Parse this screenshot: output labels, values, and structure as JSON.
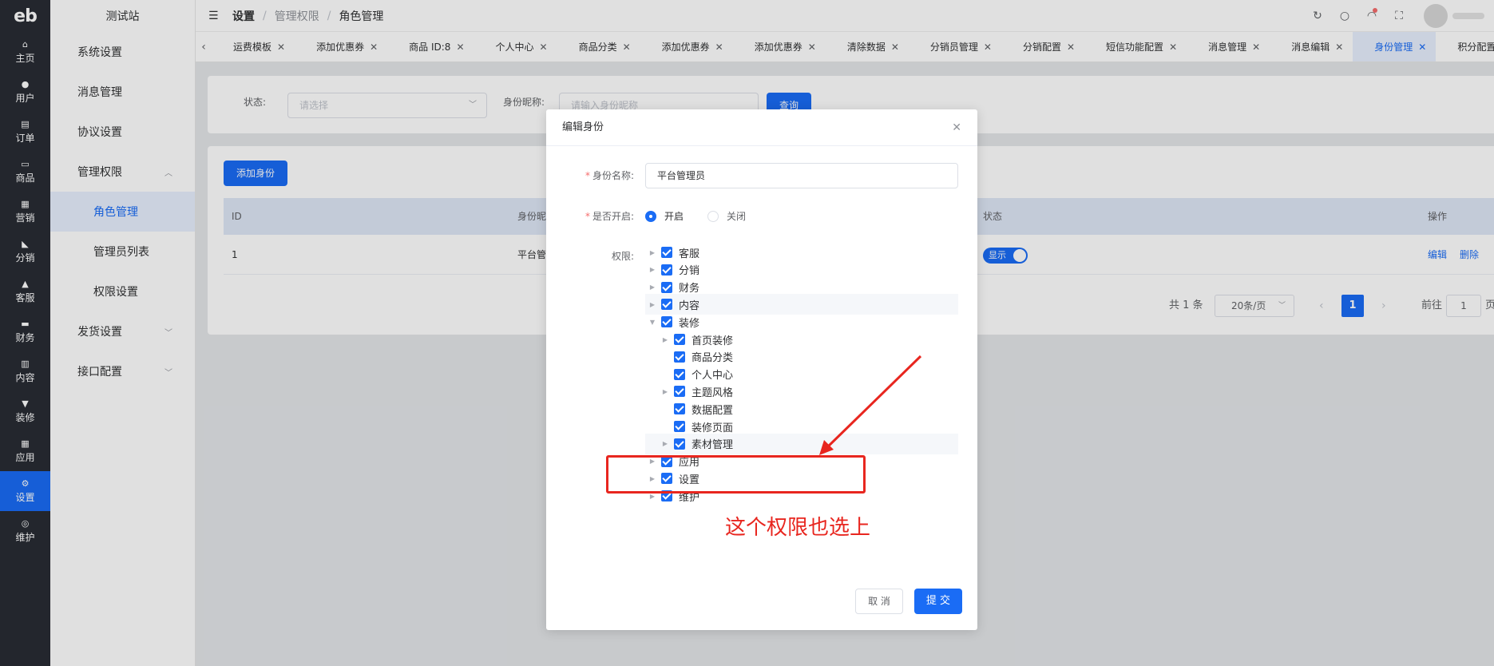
{
  "logo": "eb",
  "rail": [
    {
      "icon": "⌂",
      "label": "主页"
    },
    {
      "icon": "●",
      "label": "用户"
    },
    {
      "icon": "▤",
      "label": "订单"
    },
    {
      "icon": "▭",
      "label": "商品"
    },
    {
      "icon": "▦",
      "label": "营销"
    },
    {
      "icon": "◣",
      "label": "分销"
    },
    {
      "icon": "▲",
      "label": "客服"
    },
    {
      "icon": "▬",
      "label": "财务"
    },
    {
      "icon": "▥",
      "label": "内容"
    },
    {
      "icon": "▼",
      "label": "装修"
    },
    {
      "icon": "▦",
      "label": "应用"
    },
    {
      "icon": "⚙",
      "label": "设置"
    },
    {
      "icon": "◎",
      "label": "维护"
    }
  ],
  "submenu": {
    "title": "测试站",
    "items": [
      "系统设置",
      "消息管理",
      "协议设置",
      "管理权限",
      "角色管理",
      "管理员列表",
      "权限设置",
      "发货设置",
      "接口配置"
    ]
  },
  "header": {
    "breadcrumb": [
      "设置",
      "管理权限",
      "角色管理"
    ],
    "separator": "/"
  },
  "tabs": [
    "运费模板",
    "添加优惠券",
    "商品 ID:8",
    "个人中心",
    "商品分类",
    "添加优惠券",
    "添加优惠券",
    "清除数据",
    "分销员管理",
    "分销配置",
    "短信功能配置",
    "消息管理",
    "消息编辑",
    "身份管理",
    "积分配置"
  ],
  "filter": {
    "status_label": "状态:",
    "status_placeholder": "请选择",
    "nickname_label": "身份昵称:",
    "nickname_placeholder": "请输入身份昵称",
    "query_button": "查询"
  },
  "table": {
    "add_button": "添加身份",
    "columns": [
      "ID",
      "身份昵",
      "状态",
      "操作"
    ],
    "row": {
      "id": "1",
      "name": "平台管",
      "switch_label": "显示",
      "edit": "编辑",
      "delete": "删除"
    }
  },
  "pagination": {
    "total": "共 1 条",
    "page_size": "20条/页",
    "current": "1",
    "goto_label": "前往",
    "goto_value": "1",
    "unit": "页"
  },
  "dialog": {
    "title": "编辑身份",
    "name_label": "身份名称:",
    "name_value": "平台管理员",
    "enable_label": "是否开启:",
    "enable_on": "开启",
    "enable_off": "关闭",
    "perm_label": "权限:",
    "tree": [
      "客服",
      "分销",
      "财务",
      "内容",
      "装修",
      "首页装修",
      "商品分类",
      "个人中心",
      "主题风格",
      "数据配置",
      "装修页面",
      "素材管理",
      "应用",
      "设置",
      "维护"
    ],
    "cancel": "取 消",
    "submit": "提 交"
  },
  "annotation": {
    "text": "这个权限也选上",
    "color": "#e8261f"
  },
  "colors": {
    "primary": "#1a6cf5",
    "rail_bg": "#282c34"
  }
}
